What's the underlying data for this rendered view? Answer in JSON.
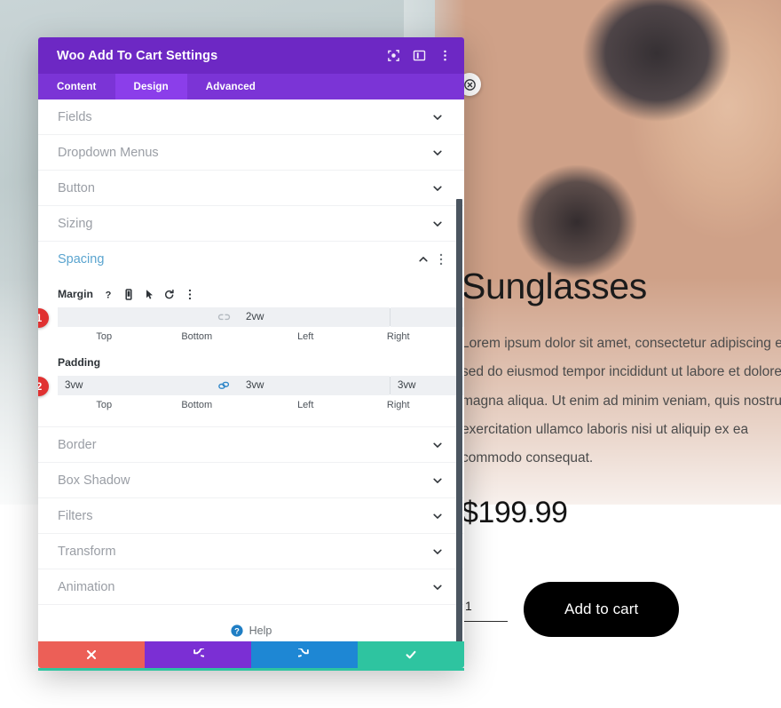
{
  "modal": {
    "title": "Woo Add To Cart Settings",
    "header_icons": [
      {
        "name": "focus-target-icon"
      },
      {
        "name": "panel-layout-icon"
      },
      {
        "name": "more-options-icon"
      }
    ],
    "tabs": [
      {
        "label": "Content",
        "active": false
      },
      {
        "label": "Design",
        "active": true
      },
      {
        "label": "Advanced",
        "active": false
      }
    ],
    "sections_above": [
      {
        "label": "Fields"
      },
      {
        "label": "Dropdown Menus"
      },
      {
        "label": "Button"
      },
      {
        "label": "Sizing"
      }
    ],
    "spacing": {
      "label": "Spacing",
      "margin": {
        "label": "Margin",
        "badge": "1",
        "link_state": "unlinked",
        "fields": [
          {
            "caption": "Top",
            "value": ""
          },
          {
            "caption": "Bottom",
            "value": "2vw"
          },
          {
            "caption": "Left",
            "value": ""
          },
          {
            "caption": "Right",
            "value": ""
          }
        ],
        "tool_icons": [
          "help-icon",
          "responsive-icon",
          "hover-icon",
          "reset-icon",
          "more-options-icon"
        ]
      },
      "padding": {
        "label": "Padding",
        "badge": "2",
        "link_state": "linked",
        "fields": [
          {
            "caption": "Top",
            "value": "3vw"
          },
          {
            "caption": "Bottom",
            "value": "3vw"
          },
          {
            "caption": "Left",
            "value": "3vw"
          },
          {
            "caption": "Right",
            "value": "3vw"
          }
        ]
      }
    },
    "sections_below": [
      {
        "label": "Border"
      },
      {
        "label": "Box Shadow"
      },
      {
        "label": "Filters"
      },
      {
        "label": "Transform"
      },
      {
        "label": "Animation"
      }
    ],
    "help": {
      "label": "Help"
    },
    "footer_buttons": [
      {
        "name": "cancel-button",
        "icon": "close-icon"
      },
      {
        "name": "undo-button",
        "icon": "undo-icon"
      },
      {
        "name": "redo-button",
        "icon": "redo-icon"
      },
      {
        "name": "save-button",
        "icon": "check-icon"
      }
    ],
    "colors": {
      "header": "#6d28c4",
      "tabbar": "#7b34d6",
      "tab_active": "#8b3eea",
      "section_open": "#5aa4cf",
      "badge": "#e03131",
      "link_active": "#2e86c8",
      "cancel": "#ec5f57",
      "undo": "#7b2fd4",
      "redo": "#1e87d4",
      "save": "#2ec4a0"
    }
  },
  "product": {
    "title": "Sunglasses",
    "description": "Lorem ipsum dolor sit amet, consectetur adipiscing elit, sed do eiusmod tempor incididunt ut labore et dolore magna aliqua. Ut enim ad minim veniam, quis nostrud exercitation ullamco laboris nisi ut aliquip ex ea commodo consequat.",
    "price": "$199.99",
    "quantity": "1",
    "add_to_cart_label": "Add to cart"
  }
}
